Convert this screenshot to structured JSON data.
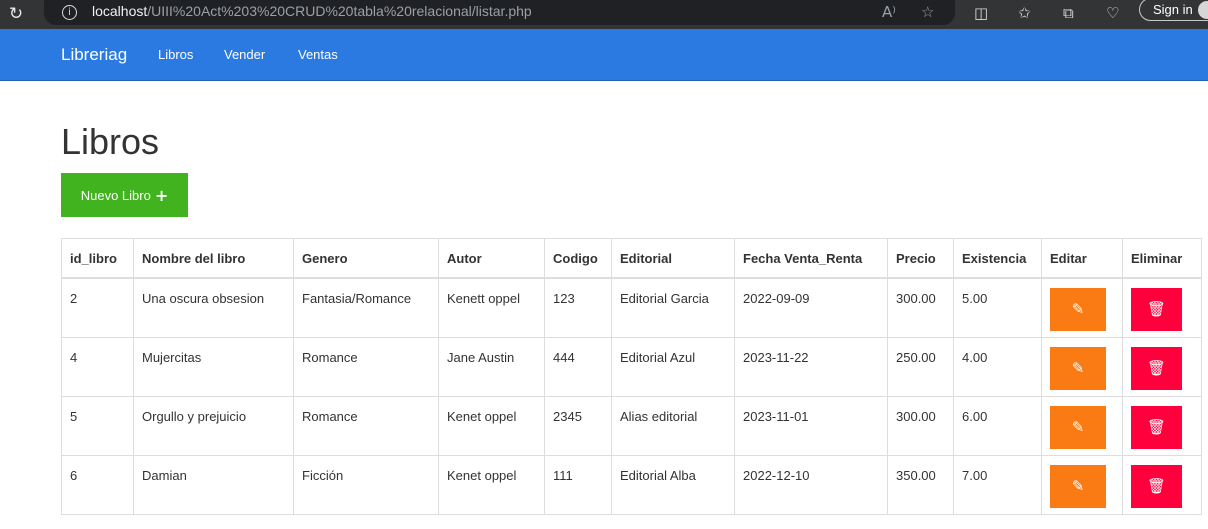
{
  "browser": {
    "url_host": "localhost",
    "url_path": "/UIII%20Act%203%20CRUD%20tabla%20relacional/listar.php",
    "sign_in": "Sign in"
  },
  "navbar": {
    "brand": "Libreriag",
    "links": [
      "Libros",
      "Vender",
      "Ventas"
    ]
  },
  "page": {
    "title": "Libros",
    "new_button": "Nuevo Libro",
    "plus_icon": "+"
  },
  "table": {
    "headers": [
      "id_libro",
      "Nombre del libro",
      "Genero",
      "Autor",
      "Codigo",
      "Editorial",
      "Fecha Venta_Renta",
      "Precio",
      "Existencia",
      "Editar",
      "Eliminar"
    ],
    "rows": [
      [
        "2",
        "Una oscura obsesion",
        "Fantasia/Romance",
        "Kenett oppel",
        "123",
        "Editorial Garcia",
        "2022-09-09",
        "300.00",
        "5.00"
      ],
      [
        "4",
        "Mujercitas",
        "Romance",
        "Jane Austin",
        "444",
        "Editorial Azul",
        "2023-11-22",
        "250.00",
        "4.00"
      ],
      [
        "5",
        "Orgullo y prejuicio",
        "Romance",
        "Kenet oppel",
        "2345",
        "Alias editorial",
        "2023-11-01",
        "300.00",
        "6.00"
      ],
      [
        "6",
        "Damian",
        "Ficción",
        "Kenet oppel",
        "111",
        "Editorial Alba",
        "2022-12-10",
        "350.00",
        "7.00"
      ]
    ]
  },
  "icons": {
    "edit": "edit-icon",
    "delete": "trash-icon"
  },
  "colors": {
    "navbar": "#2a7ae2",
    "new_button": "#40b31e",
    "edit_button": "#fa7a14",
    "delete_button": "#ff003d"
  }
}
